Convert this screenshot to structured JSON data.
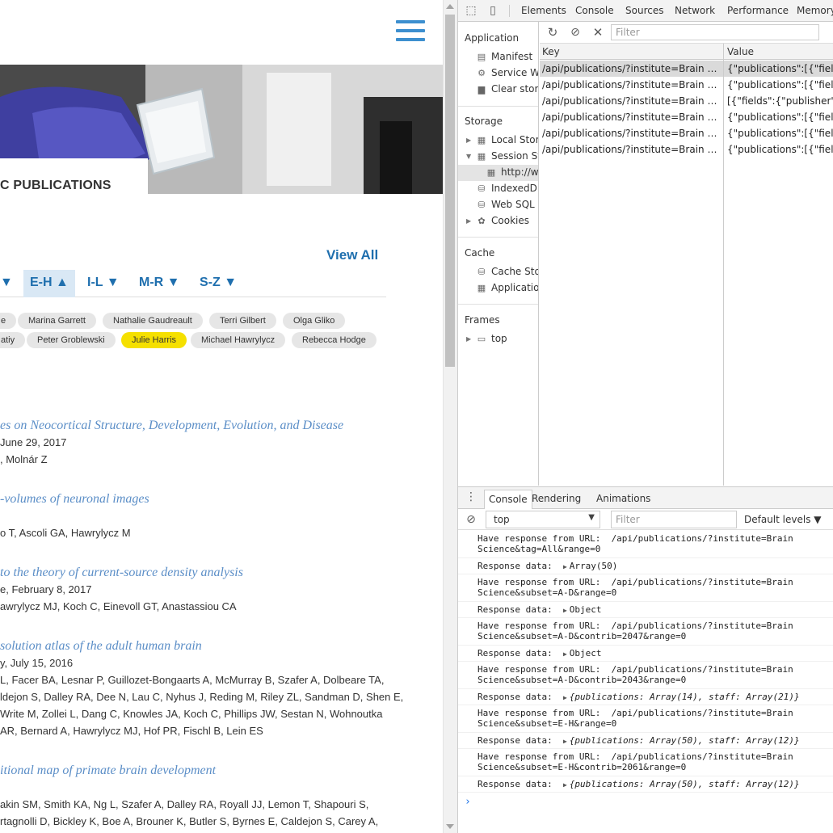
{
  "site": {
    "hero_title": "C PUBLICATIONS",
    "view_all": "View All",
    "alpha_tabs": [
      {
        "label": "▼",
        "active": false
      },
      {
        "label": "E-H ▲",
        "active": true
      },
      {
        "label": "I-L ▼",
        "active": false
      },
      {
        "label": "M-R ▼",
        "active": false
      },
      {
        "label": "S-Z ▼",
        "active": false
      }
    ],
    "chips_row1": [
      "e",
      "Marina Garrett",
      "Nathalie Gaudreault",
      "Terri Gilbert",
      "Olga Gliko"
    ],
    "chips_row2": [
      "atiy",
      "Peter Groblewski",
      "Julie Harris",
      "Michael Hawrylycz",
      "Rebecca Hodge"
    ],
    "highlighted_chip": "Julie Harris",
    "publications": [
      {
        "title": "es on Neocortical Structure, Development, Evolution, and Disease",
        "lines": [
          "June 29, 2017",
          ", Molnár Z"
        ]
      },
      {
        "title": "-volumes of neuronal images",
        "lines": [
          "",
          "o T, Ascoli GA, Hawrylycz M"
        ]
      },
      {
        "title": " to the theory of current-source density analysis",
        "lines": [
          "e, February 8, 2017",
          "awrylycz MJ, Koch C, Einevoll GT, Anastassiou CA"
        ]
      },
      {
        "title": "solution atlas of the adult human brain",
        "lines": [
          "y, July 15, 2016",
          "L, Facer BA, Lesnar P, Guillozet-Bongaarts A, McMurray B, Szafer A, Dolbeare TA,",
          "ldejon S, Dalley RA, Dee N, Lau C, Nyhus J, Reding M, Riley ZL, Sandman D, Shen E,",
          " Write M, Zollei L, Dang C, Knowles JA, Koch C, Phillips JW, Sestan N, Wohnoutka",
          "AR, Bernard A, Hawrylycz MJ, Hof PR, Fischl B, Lein ES"
        ]
      },
      {
        "title": "itional map of primate brain development",
        "lines": [
          "",
          "akin SM, Smith KA, Ng L, Szafer A, Dalley RA, Royall JJ, Lemon T, Shapouri S,",
          "rtagnolli D, Bickley K, Boe A, Brouner K, Butler S, Byrnes E, Caldejon S, Carey A,"
        ]
      }
    ]
  },
  "devtools": {
    "tabs": [
      "Elements",
      "Console",
      "Sources",
      "Network",
      "Performance",
      "Memory"
    ],
    "sidebar": {
      "application_head": "Application",
      "application_items": [
        "Manifest",
        "Service Wo",
        "Clear stora"
      ],
      "storage_head": "Storage",
      "storage_items": [
        "Local Stora",
        "Session Sto",
        "http://w",
        "IndexedDB",
        "Web SQL",
        "Cookies"
      ],
      "cache_head": "Cache",
      "cache_items": [
        "Cache Stor",
        "Application"
      ],
      "frames_head": "Frames",
      "frames_items": [
        "top"
      ]
    },
    "storage": {
      "filter_placeholder": "Filter",
      "columns": [
        "Key",
        "Value"
      ],
      "rows": [
        {
          "key": "/api/publications/?institute=Brain Scien...",
          "value": "{\"publications\":[{\"fields\":{",
          "selected": true
        },
        {
          "key": "/api/publications/?institute=Brain Scien...",
          "value": "{\"publications\":[{\"fields\":{",
          "selected": false
        },
        {
          "key": "/api/publications/?institute=Brain Scien...",
          "value": "[{\"fields\":{\"publisher\":\"Inte",
          "selected": false
        },
        {
          "key": "/api/publications/?institute=Brain Scien...",
          "value": "{\"publications\":[{\"fields\":{",
          "selected": false
        },
        {
          "key": "/api/publications/?institute=Brain Scien...",
          "value": "{\"publications\":[{\"fields\":{",
          "selected": false
        },
        {
          "key": "/api/publications/?institute=Brain Scien...",
          "value": "{\"publications\":[{\"fields\":{",
          "selected": false
        }
      ]
    },
    "drawer_tabs": [
      "Console",
      "Rendering",
      "Animations"
    ],
    "console": {
      "context": "top",
      "filter_placeholder": "Filter",
      "levels": "Default levels ▼",
      "entries": [
        {
          "text": "Have response from URL:  /api/publications/?institute=Brain\nScience&tag=All&range=0"
        },
        {
          "text": "Response data:  ",
          "obj": "Array(50)",
          "italic": false
        },
        {
          "text": "Have response from URL:  /api/publications/?institute=Brain\nScience&subset=A-D&range=0"
        },
        {
          "text": "Response data:  ",
          "obj": "Object",
          "italic": false
        },
        {
          "text": "Have response from URL:  /api/publications/?institute=Brain\nScience&subset=A-D&contrib=2047&range=0"
        },
        {
          "text": "Response data:  ",
          "obj": "Object",
          "italic": false
        },
        {
          "text": "Have response from URL:  /api/publications/?institute=Brain\nScience&subset=A-D&contrib=2043&range=0"
        },
        {
          "text": "Response data:  ",
          "obj": "{publications: Array(14), staff: Array(21)}",
          "italic": true
        },
        {
          "text": "Have response from URL:  /api/publications/?institute=Brain\nScience&subset=E-H&range=0"
        },
        {
          "text": "Response data:  ",
          "obj": "{publications: Array(50), staff: Array(12)}",
          "italic": true
        },
        {
          "text": "Have response from URL:  /api/publications/?institute=Brain\nScience&subset=E-H&contrib=2061&range=0"
        },
        {
          "text": "Response data:  ",
          "obj": "{publications: Array(50), staff: Array(12)}",
          "italic": true
        }
      ]
    }
  }
}
